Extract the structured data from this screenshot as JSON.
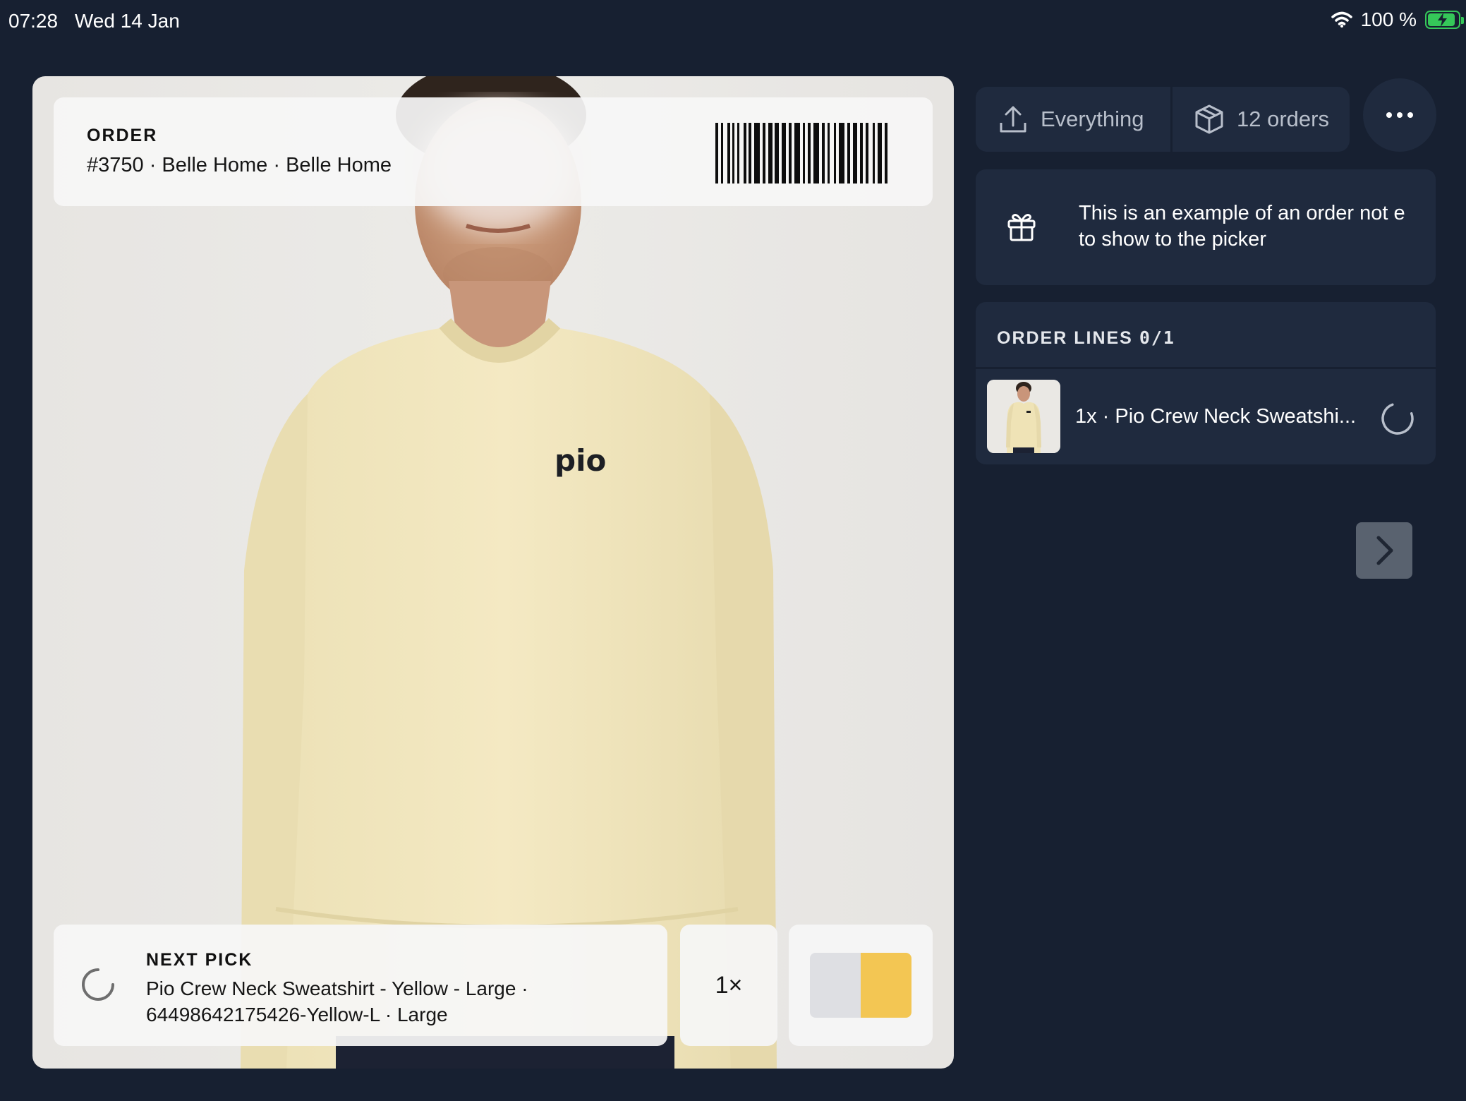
{
  "status_bar": {
    "time": "07:28",
    "date": "Wed 14 Jan",
    "battery": "100 %",
    "battery_color": "#35c759"
  },
  "order": {
    "label": "ORDER",
    "info": "#3750 · Belle Home · Belle Home"
  },
  "next_pick": {
    "label": "NEXT PICK",
    "text": "Pio Crew Neck Sweatshirt - Yellow - Large · 64498642175426-Yellow-L · Large",
    "quantity": "1×"
  },
  "product": {
    "logo_text": "pio",
    "swatch_colors": [
      "#dedfe3",
      "#f3c653"
    ]
  },
  "toolbar": {
    "scope_label": "Everything",
    "orders_label": "12 orders"
  },
  "note": {
    "text": "This is an example of an order not e to show to the picker"
  },
  "order_lines": {
    "title": "ORDER LINES",
    "count": "0/1",
    "items": [
      {
        "text": "1x · Pio Crew Neck Sweatshi..."
      }
    ]
  },
  "colors": {
    "background": "#172031",
    "card": "#1f2a3e",
    "muted_text": "#b8bfcb"
  }
}
